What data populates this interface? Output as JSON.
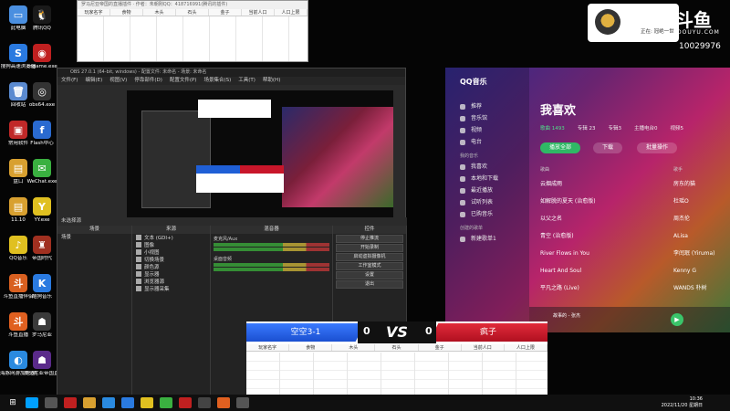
{
  "desktop_icons": [
    {
      "label": "此电脑",
      "color": "#4a8fe0",
      "glyph": "▭"
    },
    {
      "label": "腾讯QQ",
      "color": "#1a1a1a",
      "glyph": "🐧"
    },
    {
      "label": "搜狗高速浏览器",
      "color": "#2a7ae0",
      "glyph": "S"
    },
    {
      "label": "cngame.exe",
      "color": "#c02020",
      "glyph": "◉"
    },
    {
      "label": "回收站",
      "color": "#5a8ad0",
      "glyph": "🗑"
    },
    {
      "label": "obs64.exe",
      "color": "#333",
      "glyph": "◎"
    },
    {
      "label": "常用软件",
      "color": "#c02828",
      "glyph": "▣"
    },
    {
      "label": "Flash中心",
      "color": "#2a6ad0",
      "glyph": "f"
    },
    {
      "label": "盘口",
      "color": "#d8a030",
      "glyph": "▤"
    },
    {
      "label": "WeChat.exe",
      "color": "#3ab040",
      "glyph": "✉"
    },
    {
      "label": "11.10",
      "color": "#d8a030",
      "glyph": "▤"
    },
    {
      "label": "YY.exe",
      "color": "#e0c020",
      "glyph": "Y"
    },
    {
      "label": "QQ音乐",
      "color": "#e0c020",
      "glyph": "♪"
    },
    {
      "label": "帝国时代",
      "color": "#a03020",
      "glyph": "♜"
    },
    {
      "label": "斗鱼直播伴侣",
      "color": "#d86020",
      "glyph": "斗"
    },
    {
      "label": "酷狗音乐",
      "color": "#2a7ae0",
      "glyph": "K"
    },
    {
      "label": "斗鱼直播",
      "color": "#e06020",
      "glyph": "斗"
    },
    {
      "label": "罗马尼亚",
      "color": "#3a3a3a",
      "glyph": "☗"
    },
    {
      "label": "海豚网游加速器5.0",
      "color": "#2a8ae0",
      "glyph": "◐"
    },
    {
      "label": "罗马尼亚帝国直播板",
      "color": "#5a2a8a",
      "glyph": "☗"
    }
  ],
  "table_top": {
    "title": "罗马尼亚帝国的直播插件 · 作者：朱朝刚QQ：418716991(腾讯的插件)",
    "columns": [
      "玩家名字",
      "食物",
      "木头",
      "石头",
      "金子",
      "当前人口",
      "人口上限"
    ]
  },
  "obs": {
    "title": "OBS 27.0.1 (64-bit, windows) - 配置文件: 未命名 - 场景: 未命名",
    "menus": [
      "文件(F)",
      "编辑(E)",
      "视图(V)",
      "停靠部件(D)",
      "配置文件(P)",
      "场景集合(S)",
      "工具(T)",
      "帮助(H)"
    ],
    "status": "未选择源",
    "docks": {
      "scenes": {
        "title": "场景",
        "items": [
          "场景"
        ]
      },
      "sources": {
        "title": "来源",
        "items": [
          "文本 (GDI+)",
          "图像",
          "小视图",
          "切换场景",
          "颜色源",
          "显示器",
          "浏览器源",
          "显示器采集"
        ]
      },
      "mixer": {
        "title": "混音器",
        "channels": [
          "麦克风/Aux",
          "桌面音频"
        ]
      },
      "controls": {
        "title": "控件",
        "buttons": [
          "停止推流",
          "开始录制",
          "启动虚拟摄像机",
          "工作室模式",
          "设置",
          "退出"
        ]
      }
    }
  },
  "qqmusic": {
    "logo": "QQ音乐",
    "side": [
      {
        "section": "",
        "items": [
          "推荐",
          "音乐馆",
          "视频",
          "电台"
        ]
      },
      {
        "section": "我的音乐",
        "items": [
          "我喜欢",
          "本地和下载",
          "最近播放",
          "试听列表",
          "已购音乐"
        ]
      },
      {
        "section": "创建的歌单",
        "items": [
          "新建歌单1"
        ]
      }
    ],
    "title": "我喜欢",
    "tabs": [
      "歌曲 1493",
      "专辑 23",
      "专辑3",
      "主播电台0",
      "视频5"
    ],
    "play_all": "播放全部",
    "download": "下载",
    "batch": "批量操作",
    "col_song": "歌曲",
    "col_artist": "歌手",
    "songs": [
      {
        "title": "云烟成雨",
        "artist": "房东的猫"
      },
      {
        "title": "如解脱的夏天 (治愈版)",
        "artist": "杜瑶O"
      },
      {
        "title": "以父之名",
        "artist": "周杰伦"
      },
      {
        "title": "青空 (治愈版)",
        "artist": "ALisa"
      },
      {
        "title": "River Flows in You",
        "artist": "李闰珉 (Yiruma)"
      },
      {
        "title": "Heart And Soul",
        "artist": "Kenny G"
      },
      {
        "title": "平凡之路 (Live)",
        "artist": "WANDS 朴树"
      }
    ],
    "now_playing": "故事的 - 张杰"
  },
  "douyu": {
    "logo": "斗鱼",
    "url": "DOUYU.COM",
    "room_id": "10029976",
    "follow": "正在: 冠绝一世"
  },
  "vs": {
    "left_team": "空空3-1",
    "right_team": "疯子",
    "left_score": "0",
    "right_score": "0",
    "vs_text": "VS",
    "columns": [
      "玩家名字",
      "食物",
      "木头",
      "石头",
      "金子",
      "当前人口",
      "人口上限"
    ]
  },
  "taskbar": {
    "time": "10:36",
    "date": "2022/11/20 星期日",
    "apps": [
      "#00a0ff",
      "#555",
      "#c02020",
      "#d8a030",
      "#2a8ae0",
      "#2a7ae0",
      "#e0c020",
      "#3ab040",
      "#c02020",
      "#444",
      "#e06020",
      "#555"
    ]
  }
}
